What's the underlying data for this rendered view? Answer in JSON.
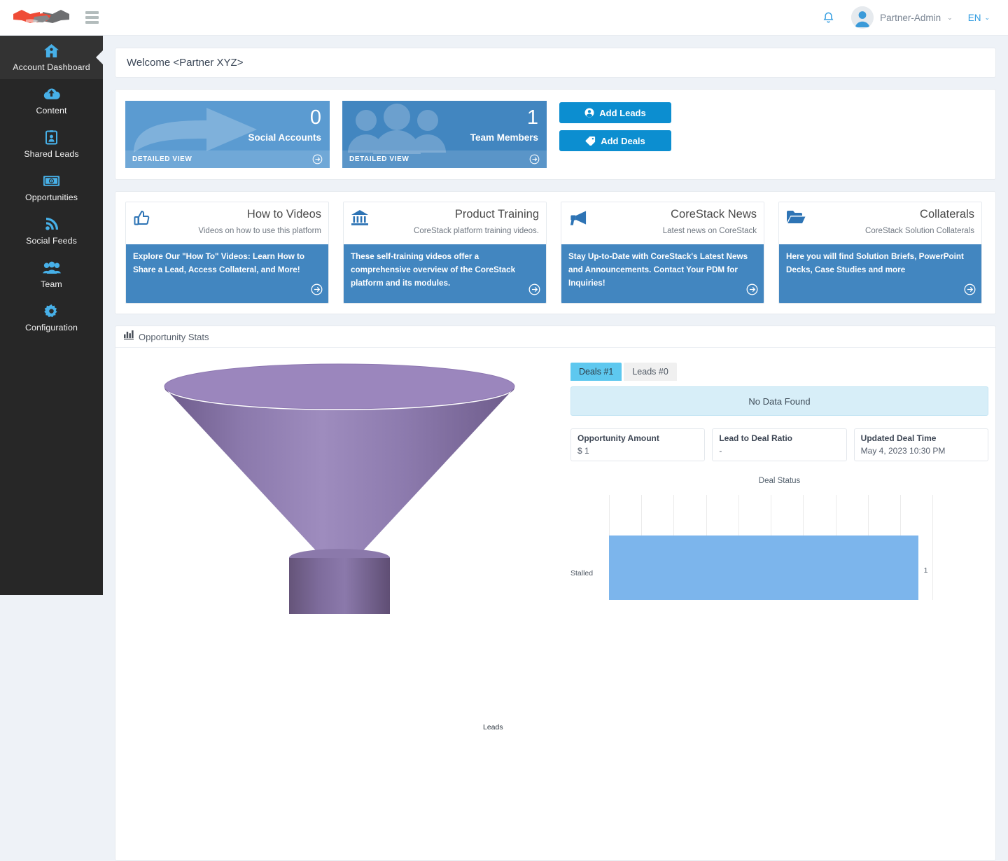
{
  "header": {
    "logo_name": "handshake-logo",
    "menu_icon": "hamburger-icon",
    "notification_icon": "bell-icon",
    "avatar_icon": "user-avatar",
    "user_name": "Partner-Admin",
    "user_caret": "⌄",
    "language": "EN",
    "language_caret": "⌄"
  },
  "sidebar": {
    "items": [
      {
        "label": "Account Dashboard",
        "icon": "home-icon",
        "active": true
      },
      {
        "label": "Content",
        "icon": "cloud-upload-icon",
        "active": false
      },
      {
        "label": "Shared Leads",
        "icon": "id-card-icon",
        "active": false
      },
      {
        "label": "Opportunities",
        "icon": "money-bill-icon",
        "active": false
      },
      {
        "label": "Social Feeds",
        "icon": "rss-icon",
        "active": false
      },
      {
        "label": "Team",
        "icon": "users-icon",
        "active": false
      },
      {
        "label": "Configuration",
        "icon": "gear-icon",
        "active": false
      }
    ]
  },
  "welcome": {
    "text": "Welcome <Partner XYZ>"
  },
  "tiles": [
    {
      "value": "0",
      "label": "Social Accounts",
      "footer": "DETAILED VIEW",
      "watermark_icon": "share-arrow-icon",
      "arrow_icon": "arrow-circle-right-icon",
      "color": "#5b9bd1"
    },
    {
      "value": "1",
      "label": "Team Members",
      "footer": "DETAILED VIEW",
      "watermark_icon": "users-group-icon",
      "arrow_icon": "arrow-circle-right-icon",
      "color": "#4286c0"
    }
  ],
  "actions": [
    {
      "label": "Add Leads",
      "icon": "user-circle-icon",
      "color": "#0c8ed0"
    },
    {
      "label": "Add Deals",
      "icon": "tag-icon",
      "color": "#0c8ed0"
    }
  ],
  "cards": [
    {
      "title": "How to Videos",
      "subtitle": "Videos on how to use this platform",
      "description": "Explore Our \"How To\" Videos: Learn How to Share a Lead, Access Collateral, and More!",
      "icon": "thumbs-up-icon",
      "arrow_icon": "arrow-circle-right-icon"
    },
    {
      "title": "Product Training",
      "subtitle": "CoreStack platform training videos.",
      "description": "These self-training videos offer a comprehensive overview of the CoreStack platform and its modules.",
      "icon": "bank-icon",
      "arrow_icon": "arrow-circle-right-icon"
    },
    {
      "title": "CoreStack News",
      "subtitle": "Latest news on CoreStack",
      "description": "Stay Up-to-Date with CoreStack's Latest News and Announcements. Contact Your PDM for Inquiries!",
      "icon": "bullhorn-icon",
      "arrow_icon": "arrow-circle-right-icon"
    },
    {
      "title": "Collaterals",
      "subtitle": "CoreStack Solution Collaterals",
      "description": "Here you will find Solution Briefs, PowerPoint Decks, Case Studies and more",
      "icon": "folder-open-icon",
      "arrow_icon": "arrow-circle-right-icon"
    }
  ],
  "stats": {
    "section_title": "Opportunity Stats",
    "section_icon": "bar-chart-icon",
    "tabs": [
      {
        "label": "Deals #1",
        "active": true
      },
      {
        "label": "Leads #0",
        "active": false
      }
    ],
    "no_data_text": "No Data Found",
    "metrics": [
      {
        "label": "Opportunity Amount",
        "value": "$ 1"
      },
      {
        "label": "Lead to Deal Ratio",
        "value": "-"
      },
      {
        "label": "Updated Deal Time",
        "value": "May 4, 2023 10:30 PM"
      }
    ]
  },
  "chart_data": [
    {
      "type": "funnel",
      "title": "",
      "stages": [
        {
          "label": "Leads",
          "value": 1
        }
      ],
      "labels": [
        "Leads"
      ],
      "colors": [
        "#9b86bd"
      ],
      "orientation": "vertical-3d"
    },
    {
      "type": "bar",
      "title": "Deal Status",
      "orientation": "horizontal",
      "categories": [
        "Stalled"
      ],
      "values": [
        1
      ],
      "series": [
        {
          "name": "Deal Status",
          "values": [
            1
          ]
        }
      ],
      "xlabel": "",
      "ylabel": "",
      "xlim": [
        0,
        1.15
      ],
      "grid": true,
      "gridline_count": 11,
      "data_labels": [
        "1"
      ],
      "bar_color": "#7cb5ec",
      "legend_position": "none"
    }
  ]
}
